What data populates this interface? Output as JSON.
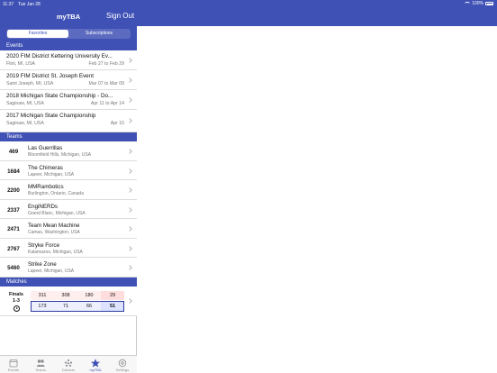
{
  "status_bar": {
    "time": "11:37",
    "date": "Tue Jan 28",
    "battery": "100%"
  },
  "nav": {
    "title": "myTBA",
    "sign_out": "Sign Out"
  },
  "segments": {
    "favorites": "Favorites",
    "subscriptions": "Subscriptions"
  },
  "sections": {
    "events": "Events",
    "teams": "Teams",
    "matches": "Matches"
  },
  "events": [
    {
      "title": "2020 FIM District Kettering University Ev...",
      "location": "Flint, MI, USA",
      "dates": "Feb 27 to Feb 29"
    },
    {
      "title": "2019 FIM District St. Joseph Event",
      "location": "Saint Joseph, MI, USA",
      "dates": "Mar 07 to Mar 09"
    },
    {
      "title": "2018 Michigan State Championship - Do...",
      "location": "Saginaw, MI, USA",
      "dates": "Apr 11 to Apr 14"
    },
    {
      "title": "2017 Michigan State Championship",
      "location": "Saginaw, MI, USA",
      "dates": "Apr 15"
    }
  ],
  "teams": [
    {
      "number": "469",
      "name": "Las Guerrillas",
      "location": "Bloomfield Hills, Michigan, USA"
    },
    {
      "number": "1684",
      "name": "The Chimeras",
      "location": "Lapeer, Michigan, USA"
    },
    {
      "number": "2200",
      "name": "MMRambotics",
      "location": "Burlington, Ontario, Canada"
    },
    {
      "number": "2337",
      "name": "EngiNERDs",
      "location": "Grand Blanc, Michigan, USA"
    },
    {
      "number": "2471",
      "name": "Team Mean Machine",
      "location": "Camas, Washington, USA"
    },
    {
      "number": "2767",
      "name": "Stryke Force",
      "location": "Kalamazoo, Michigan, USA"
    },
    {
      "number": "5460",
      "name": "Strike Zone",
      "location": "Lapeer, Michigan, USA"
    }
  ],
  "match": {
    "label": "Finals",
    "sublabel": "1-3",
    "red": [
      "311",
      "308",
      "180"
    ],
    "red_score": "29",
    "blue": [
      "173",
      "71",
      "66"
    ],
    "blue_score": "51"
  },
  "tabs": [
    {
      "label": "Events",
      "icon": "calendar-icon"
    },
    {
      "label": "Teams",
      "icon": "people-icon"
    },
    {
      "label": "Districts",
      "icon": "districts-icon"
    },
    {
      "label": "myTBA",
      "icon": "star-icon",
      "active": true
    },
    {
      "label": "Settings",
      "icon": "gear-icon"
    }
  ],
  "colors": {
    "primary": "#3f51b5",
    "red_alliance": "#ffeeee",
    "blue_alliance": "#eef0ff"
  }
}
